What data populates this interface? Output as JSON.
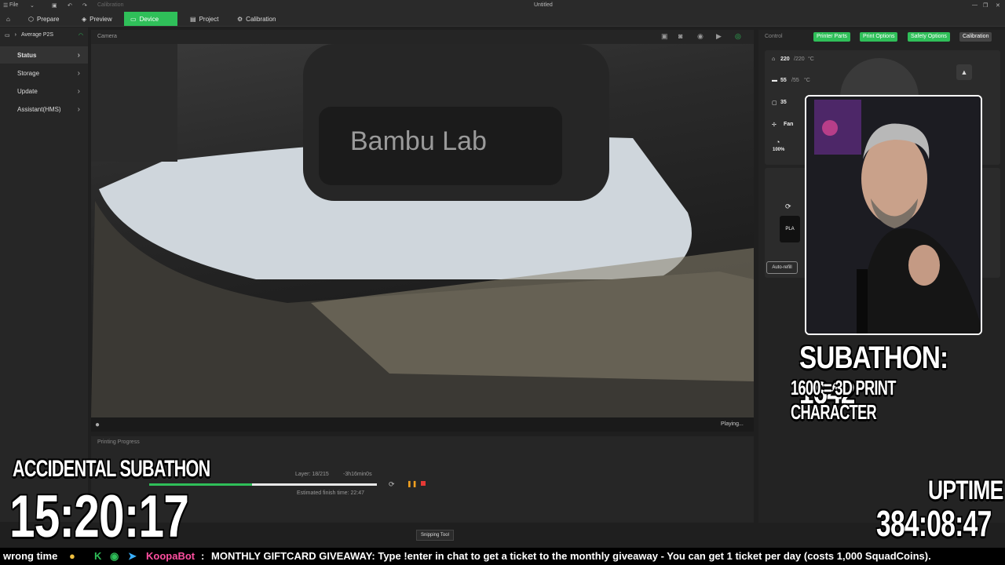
{
  "titlebar": {
    "file_menu": "File",
    "app_title": "Untitled",
    "calibration_hint": "Calibration"
  },
  "nav": {
    "tabs": [
      {
        "label": "Prepare"
      },
      {
        "label": "Preview"
      },
      {
        "label": "Device"
      },
      {
        "label": "Project"
      },
      {
        "label": "Calibration"
      }
    ]
  },
  "sidebar": {
    "printer_name": "Average P2S",
    "items": [
      {
        "label": "Status"
      },
      {
        "label": "Storage"
      },
      {
        "label": "Update"
      },
      {
        "label": "Assistant(HMS)"
      }
    ]
  },
  "camera": {
    "title": "Camera",
    "status": "Playing...",
    "brand_text": "Bambu Lab"
  },
  "progress": {
    "title": "Printing Progress",
    "layer": "Layer: 18/215",
    "remaining": "-3h16min0s",
    "finish": "Estimated finish time: 22:47",
    "fraction": 0.45
  },
  "control": {
    "title": "Control",
    "tabs": [
      {
        "label": "Printer Parts"
      },
      {
        "label": "Print Options"
      },
      {
        "label": "Safety Options"
      },
      {
        "label": "Calibration"
      }
    ],
    "nozzle_temp": "220",
    "nozzle_target": "/220",
    "bed_temp": "55",
    "bed_target": "/55",
    "chamber_temp": "35",
    "unit": "°C",
    "fan_label": "Fan",
    "speed_value": "100%",
    "filament": "PLA",
    "auto_refill": "Auto-refill"
  },
  "stream": {
    "subathon_count": "SUBATHON: 1642",
    "subathon_goal": "1600 = 3D PRINT CHARACTER",
    "accidental_title": "ACCIDENTAL SUBATHON",
    "accidental_timer": "15:20:17",
    "uptime_label": "UPTIME",
    "uptime_value": "384:08:47",
    "tooltip": "Snipping Tool"
  },
  "ticker": {
    "lead": "wrong time",
    "bot": "KoopaBot",
    "message": "MONTHLY GIFTCARD GIVEAWAY: Type !enter in chat to get a ticket to the monthly giveaway - You can get 1 ticket per day (costs 1,000 SquadCoins)."
  },
  "colors": {
    "accent": "#2fbf59",
    "stop": "#e53935",
    "pause": "#f0a020"
  }
}
